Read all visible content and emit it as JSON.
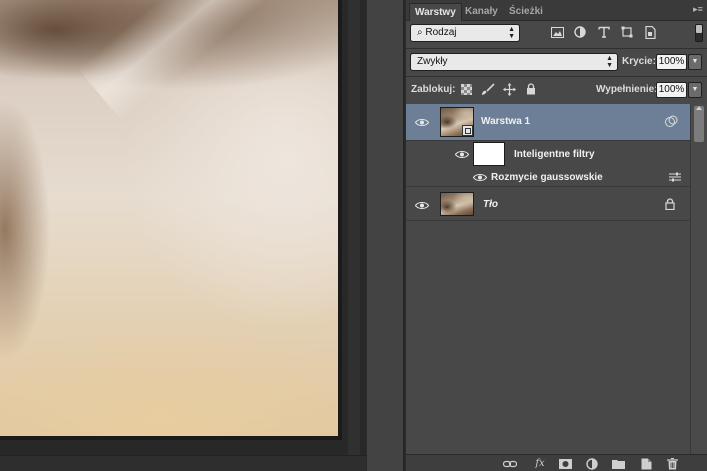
{
  "tabs": [
    {
      "label": "Warstwy",
      "active": true
    },
    {
      "label": "Kanały",
      "active": false
    },
    {
      "label": "Ścieżki",
      "active": false
    }
  ],
  "filter": {
    "kind_label": "Rodzaj",
    "icons": [
      "image-filter-icon",
      "adjustment-filter-icon",
      "type-filter-icon",
      "shape-filter-icon",
      "smart-object-filter-icon"
    ]
  },
  "blend": {
    "mode": "Zwykły",
    "opacity_label": "Krycie:",
    "opacity_value": "100%"
  },
  "lock": {
    "label": "Zablokuj:",
    "fill_label": "Wypełnienie:",
    "fill_value": "100%"
  },
  "layers": [
    {
      "name": "Warstwa 1",
      "selected": true,
      "type": "smart-object"
    },
    {
      "name": "Inteligentne filtry",
      "type": "smart-filters"
    },
    {
      "name": "Rozmycie gaussowskie",
      "type": "filter"
    },
    {
      "name": "Tło",
      "type": "background",
      "locked": true
    }
  ],
  "colors": {
    "panel_bg": "#484848",
    "selected_row": "#6d7f96",
    "tab_bar": "#3a3a3a"
  }
}
